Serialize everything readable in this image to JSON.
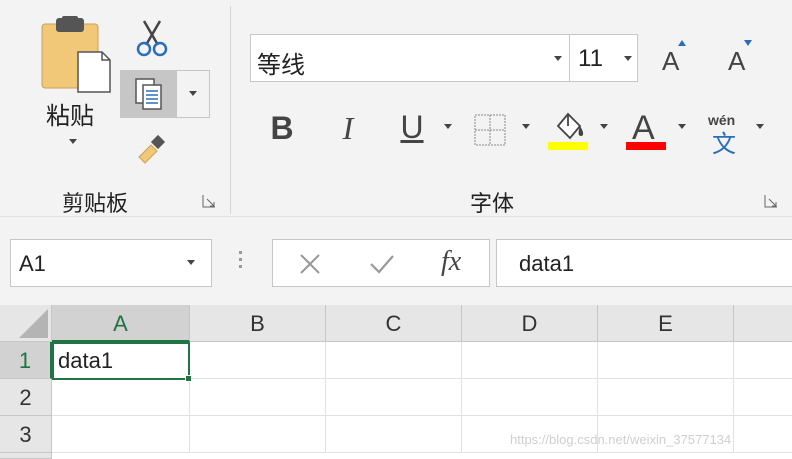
{
  "ribbon": {
    "clipboard": {
      "group_label": "剪贴板",
      "paste_label": "粘贴"
    },
    "font": {
      "group_label": "字体",
      "font_name": "等线",
      "font_size": "11",
      "bold": "B",
      "italic": "I",
      "underline": "U",
      "font_color_glyph": "A",
      "highlight_color": "#ffff00",
      "font_color": "#ff0000",
      "phonetic_top": "wén",
      "phonetic_bottom": "文"
    }
  },
  "formula_bar": {
    "name_box": "A1",
    "fx_label": "fx",
    "content": "data1"
  },
  "sheet": {
    "columns": [
      "A",
      "B",
      "C",
      "D",
      "E"
    ],
    "rows": [
      "1",
      "2",
      "3"
    ],
    "cells": {
      "A1": "data1"
    }
  },
  "watermark": "https://blog.csdn.net/weixin_37577134",
  "colors": {
    "accent": "#217346"
  }
}
